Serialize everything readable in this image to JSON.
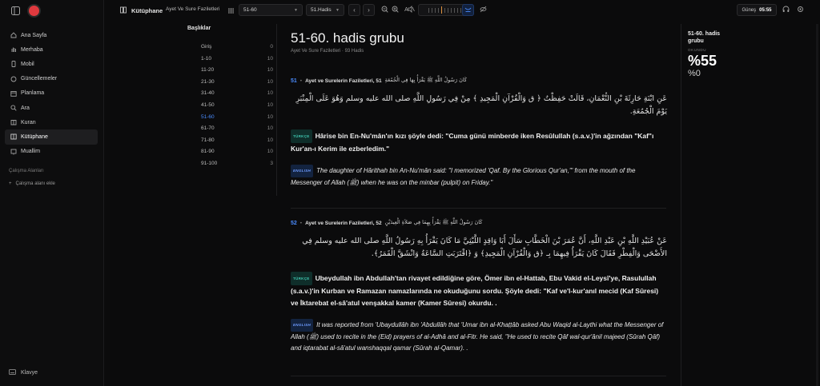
{
  "sidebar": {
    "items": [
      {
        "label": "Ana Sayfa",
        "icon": "home-icon"
      },
      {
        "label": "Merhaba",
        "icon": "hand-icon"
      },
      {
        "label": "Mobil",
        "icon": "phone-icon"
      },
      {
        "label": "Güncellemeler",
        "icon": "refresh-icon"
      },
      {
        "label": "Planlama",
        "icon": "calendar-icon"
      },
      {
        "label": "Ara",
        "icon": "search-icon"
      },
      {
        "label": "Kuran",
        "icon": "quran-icon"
      },
      {
        "label": "Kütüphane",
        "icon": "library-icon"
      },
      {
        "label": "Muallim",
        "icon": "teacher-icon"
      }
    ],
    "workspaces_title": "Çalışma Alanları",
    "workspace_add": "Çalışma alanı ekle",
    "keyboard": "Klavye"
  },
  "topbar": {
    "library": "Kütüphane",
    "book": "Ayet Ve Sure Faziletleri",
    "range_select": "51-60",
    "hadith_select": "51.Hadis",
    "sun_label": "Güneş",
    "sun_time": "05:55",
    "accent": "#4a8cff"
  },
  "headings": {
    "title": "Başlıklar",
    "rows": [
      {
        "label": "Giriş",
        "count": "0"
      },
      {
        "label": "1-10",
        "count": "10"
      },
      {
        "label": "11-20",
        "count": "10"
      },
      {
        "label": "21-30",
        "count": "10"
      },
      {
        "label": "31-40",
        "count": "10"
      },
      {
        "label": "41-50",
        "count": "10"
      },
      {
        "label": "51-60",
        "count": "10"
      },
      {
        "label": "61-70",
        "count": "10"
      },
      {
        "label": "71-80",
        "count": "10"
      },
      {
        "label": "81-90",
        "count": "10"
      },
      {
        "label": "91-100",
        "count": "3"
      }
    ],
    "active": "51-60"
  },
  "main": {
    "title": "51-60. hadis grubu",
    "subtitle": "Ayet Ve Sure Faziletleri · 93 Hadis"
  },
  "hadiths": [
    {
      "num": "51",
      "source": "Ayet ve Surelerin Faziletleri, 51",
      "arabic_short": "كَانَ رَسُولُ اللَّهِ ﷺ يَقْرَأُ بِهَا فِي الْجُمُعَةِ",
      "arabic": "عَنِ ابْنَةِ حَارِثَةَ بْنِ النُّعْمَانِ، قَالَتْ حَفِظْتُ ﴿ ق وَالْقُرْآنِ الْمَجِيدِ ﴾ مِنْ فِي رَسُولِ اللَّهِ صلى الله عليه وسلم وَهُوَ عَلَى الْمِنْبَرِ يَوْمَ الْجُمُعَةِ.",
      "tr_tag": "TÜRKÇE",
      "tr": "Hârise bin En-Nu'mân'ın kızı şöyle dedi: \"Cuma günü minberde iken Resûlullah (s.a.v.)'in ağzından \"Kaf\"ı Kur'an-ı Kerim ile ezberledim.\"",
      "en_tag": "ENGLISH",
      "en": "The daughter of Hârithah bin An-Nu'mân said: \"I memorized 'Qaf. By the Glorious Qur'an,'\" from the mouth of the Messenger of Allah (ﷺ) when he was on the minbar (pulpit) on Friday.\""
    },
    {
      "num": "52",
      "source": "Ayet ve Surelerin Faziletleri, 52",
      "arabic_short": "كَانَ رَسُولُ اللَّهِ ﷺ يَقْرَأُ بِهِمَا فِي صَلاَةِ الْعِيدَيْنِ",
      "arabic": "عَنْ عُبَيْدِ اللَّهِ بْنِ عَبْدِ اللَّهِ، أَنَّ عُمَرَ بْنَ الْخَطَّابِ سَأَلَ أَبَا وَاقِدٍ اللَّيْثِيَّ مَا كَانَ يَقْرَأُ بِهِ رَسُولُ اللَّهِ صلى الله عليه وسلم فِي الأَضْحَى وَالْفِطْرِ فَقَالَ كَانَ يَقْرَأُ فِيهِمَا بِـ ﴿ق وَالْقُرْآنِ الْمَجِيدِ﴾ وَ ﴿اقْتَرَبَتِ السَّاعَةُ وَانْشَقَّ الْقَمَرُ﴾.",
      "tr_tag": "TÜRKÇE",
      "tr": "Ubeydullah ibn Abdullah'tan rivayet edildiğine göre, Ömer ibn el-Hattab, Ebu Vakid el-Leysî'ye, Rasulullah (s.a.v.)'in Kurban ve Ramazan namazlarında ne okuduğunu sordu. Şöyle dedi: \"Kaf ve'l-kur'anıl mecid (Kaf Sûresi) ve İktarebat el-sâ'atul venşakkal kamer (Kamer Sûresi) okurdu. .",
      "en_tag": "ENGLISH",
      "en": "It was reported from 'Ubaydullâh ibn 'Abdullâh that 'Umar ibn al-Khaṭṭâb asked Abu Waqid al-Laythi what the Messenger of Allah (ﷺ) used to recite in the (Eid) prayers of al-Adhâ and al-Fitr. He said, \"He used to recite Qâf wal-qur'ânil majeed (Sûrah Qâf) and iqtarabat al-sâ'atul wanshaqqal qamar (Sûrah al-Qamar). ."
    }
  ],
  "stats": {
    "title": "51-60. hadis grubu",
    "label": "OKUNDU",
    "percent": "%55",
    "secondary": "%0"
  }
}
